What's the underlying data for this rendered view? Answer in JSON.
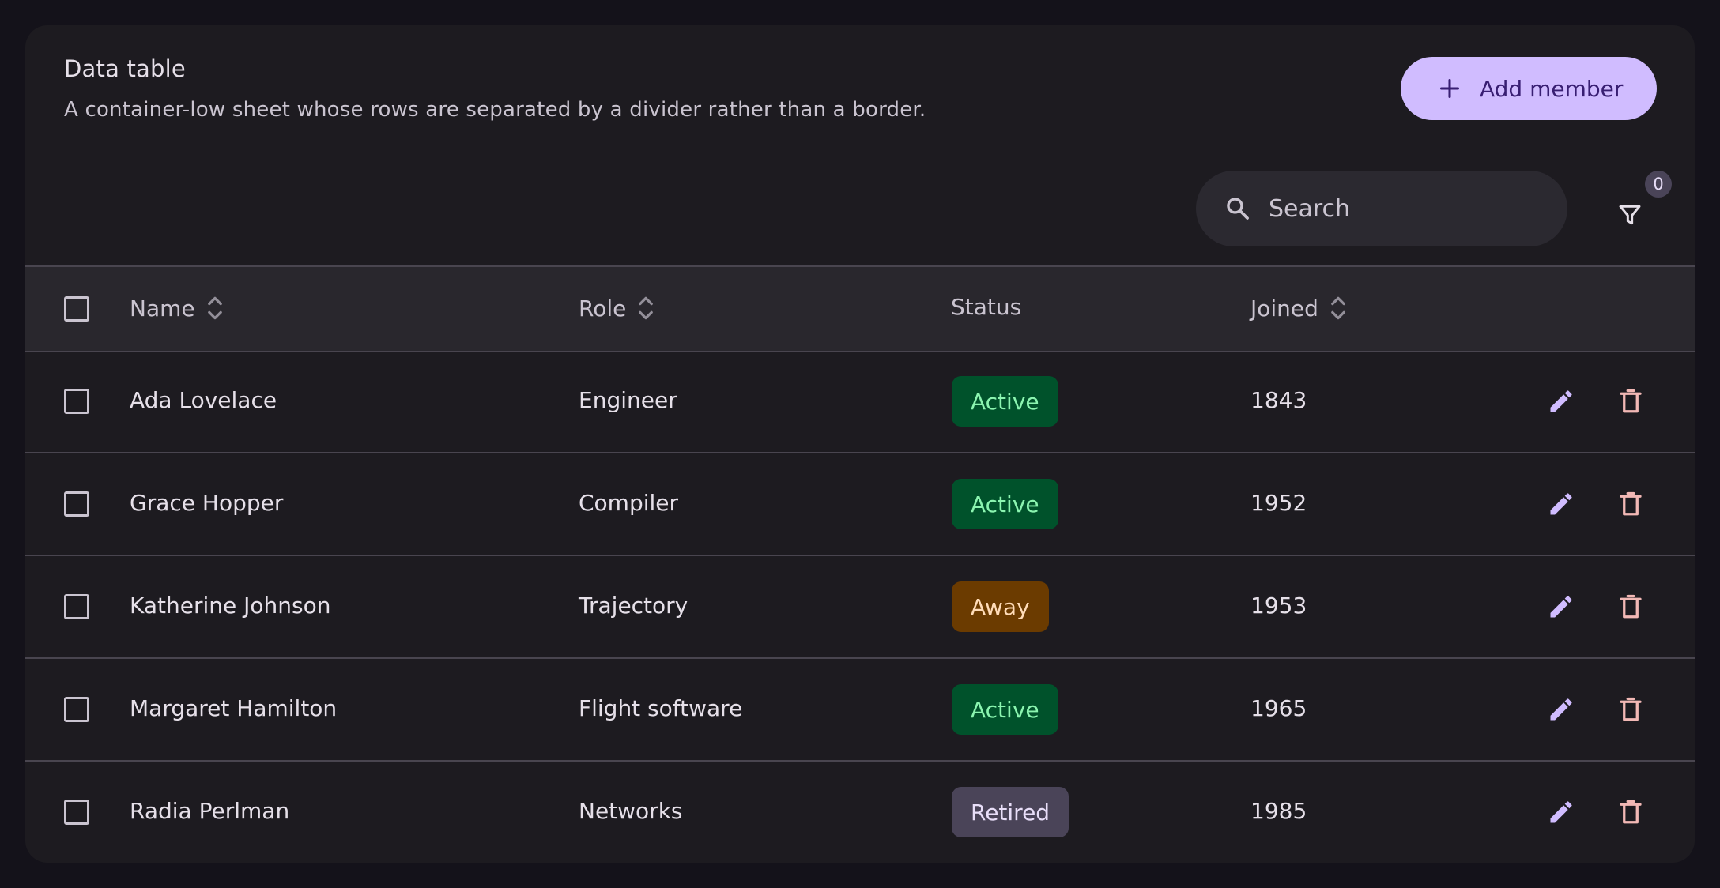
{
  "header": {
    "title": "Data table",
    "subtitle": "A container-low sheet whose rows are separated by a divider rather than a border.",
    "add_label": "Add member"
  },
  "search": {
    "placeholder": "Search",
    "value": ""
  },
  "filter": {
    "count": "0"
  },
  "columns": {
    "name": "Name",
    "role": "Role",
    "status": "Status",
    "joined": "Joined"
  },
  "rows": [
    {
      "name": "Ada Lovelace",
      "role": "Engineer",
      "status": "Active",
      "joined": "1843"
    },
    {
      "name": "Grace Hopper",
      "role": "Compiler",
      "status": "Active",
      "joined": "1952"
    },
    {
      "name": "Katherine Johnson",
      "role": "Trajectory",
      "status": "Away",
      "joined": "1953"
    },
    {
      "name": "Margaret Hamilton",
      "role": "Flight software",
      "status": "Active",
      "joined": "1965"
    },
    {
      "name": "Radia Perlman",
      "role": "Networks",
      "status": "Retired",
      "joined": "1985"
    }
  ],
  "colors": {
    "primary": "#d0bcff",
    "error": "#f2b8b5",
    "active_bg": "#00522b",
    "away_bg": "#6b3b00",
    "retired_bg": "#4a4458"
  },
  "icons": [
    "plus-icon",
    "search-icon",
    "filter-icon",
    "sort-icon",
    "edit-icon",
    "delete-icon"
  ]
}
